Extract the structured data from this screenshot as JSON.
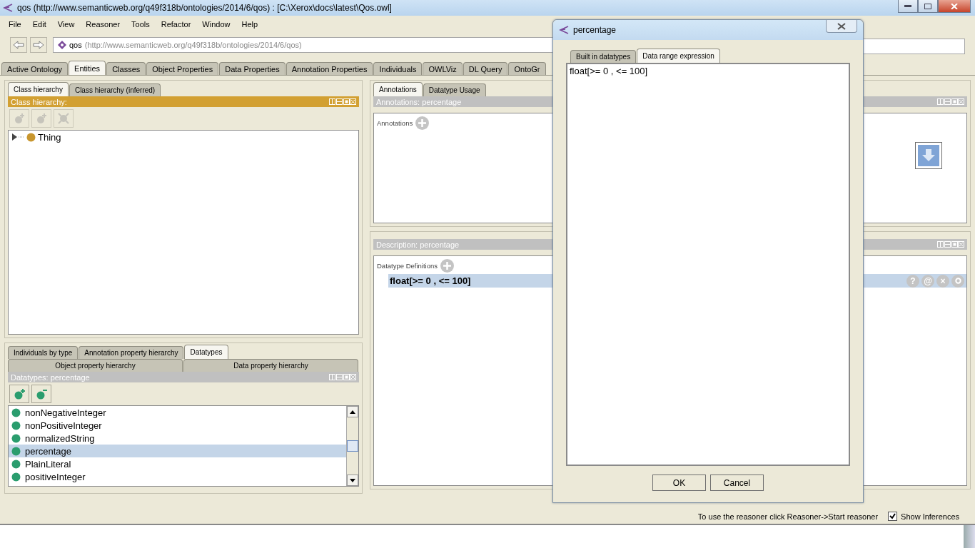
{
  "window": {
    "title": "qos (http://www.semanticweb.org/q49f318b/ontologies/2014/6/qos)  : [C:\\Xerox\\docs\\latest\\Qos.owl]"
  },
  "menu": [
    "File",
    "Edit",
    "View",
    "Reasoner",
    "Tools",
    "Refactor",
    "Window",
    "Help"
  ],
  "address": {
    "name": "qos",
    "iri": "(http://www.semanticweb.org/q49f318b/ontologies/2014/6/qos)"
  },
  "main_tabs": [
    {
      "label": "Active Ontology",
      "selected": false
    },
    {
      "label": "Entities",
      "selected": true
    },
    {
      "label": "Classes",
      "selected": false
    },
    {
      "label": "Object Properties",
      "selected": false
    },
    {
      "label": "Data Properties",
      "selected": false
    },
    {
      "label": "Annotation Properties",
      "selected": false
    },
    {
      "label": "Individuals",
      "selected": false
    },
    {
      "label": "OWLViz",
      "selected": false
    },
    {
      "label": "DL Query",
      "selected": false
    },
    {
      "label": "OntoGr",
      "selected": false
    }
  ],
  "class_panel": {
    "tabs": [
      {
        "label": "Class hierarchy",
        "selected": true
      },
      {
        "label": "Class hierarchy (inferred)",
        "selected": false
      }
    ],
    "header": "Class hierarchy:",
    "tree": [
      {
        "label": "Thing",
        "expanded": false
      }
    ]
  },
  "datatype_panel": {
    "tabs_row1": [
      {
        "label": "Individuals by type",
        "selected": false
      },
      {
        "label": "Annotation property hierarchy",
        "selected": false
      },
      {
        "label": "Datatypes",
        "selected": true
      }
    ],
    "tabs_row2": [
      {
        "label": "Object property hierarchy",
        "selected": false
      },
      {
        "label": "Data property hierarchy",
        "selected": false
      }
    ],
    "header": "Datatypes: percentage",
    "items": [
      {
        "label": "nonNegativeInteger",
        "selected": false
      },
      {
        "label": "nonPositiveInteger",
        "selected": false
      },
      {
        "label": "normalizedString",
        "selected": false
      },
      {
        "label": "percentage",
        "selected": true
      },
      {
        "label": "PlainLiteral",
        "selected": false
      },
      {
        "label": "positiveInteger",
        "selected": false
      }
    ]
  },
  "annotation_panel": {
    "tabs": [
      {
        "label": "Annotations",
        "selected": true
      },
      {
        "label": "Datatype Usage",
        "selected": false
      }
    ],
    "header": "Annotations: percentage",
    "section_label": "Annotations"
  },
  "description_panel": {
    "header": "Description: percentage",
    "section_label": "Datatype Definitions",
    "definitions": [
      {
        "text": "float[>= 0 , <= 100]",
        "selected": true,
        "actions": [
          "?",
          "@",
          "×"
        ]
      }
    ]
  },
  "dialog": {
    "title": "percentage",
    "tabs": [
      {
        "label": "Built in datatypes",
        "selected": false
      },
      {
        "label": "Data range expression",
        "selected": true
      }
    ],
    "expression": "float[>= 0 , <= 100]",
    "buttons": [
      "OK",
      "Cancel"
    ]
  },
  "status_bar": {
    "message": "To use the reasoner click Reasoner->Start reasoner",
    "show_inferences": {
      "label": "Show Inferences",
      "checked": true
    }
  }
}
